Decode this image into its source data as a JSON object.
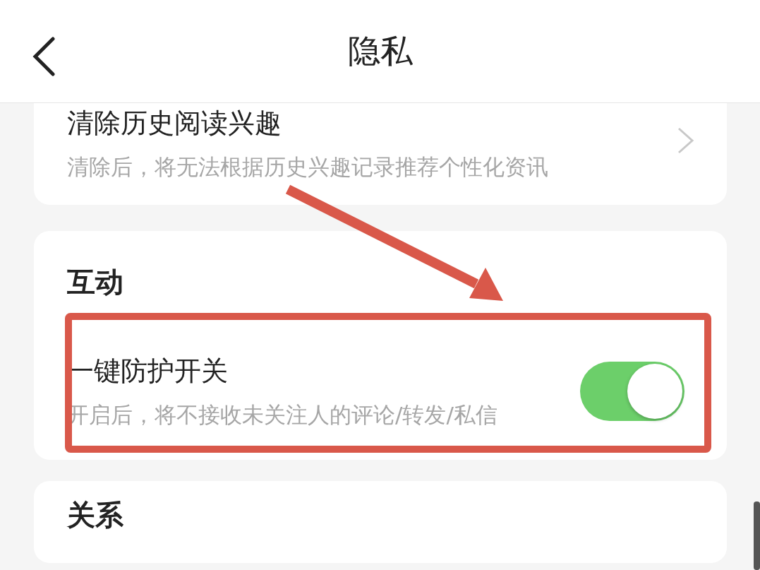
{
  "header": {
    "title": "隐私"
  },
  "sections": [
    {
      "items": [
        {
          "kind": "link",
          "title": "清除历史阅读兴趣",
          "description": "清除后，将无法根据历史兴趣记录推荐个性化资讯"
        }
      ]
    },
    {
      "heading": "互动",
      "items": [
        {
          "kind": "toggle",
          "title": "一键防护开关",
          "description": "开启后，将不接收未关注人的评论/转发/私信",
          "on": true
        }
      ]
    },
    {
      "heading": "关系"
    }
  ]
}
